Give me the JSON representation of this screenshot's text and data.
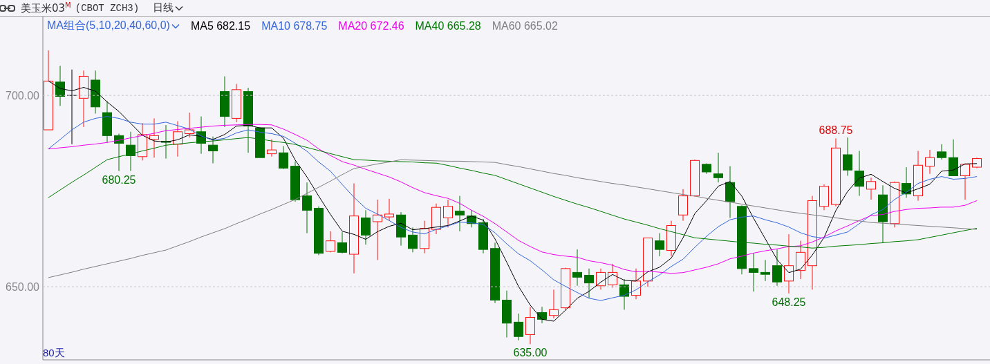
{
  "header": {
    "title": "美玉米03$^{M}$",
    "code": "(CBOT ZCH3)",
    "period": "日线"
  },
  "ma_selector": "MA组合(5,10,20,40,60,0)",
  "day_count": "80天",
  "price_chart": {
    "chart_data": {
      "type": "candlestick",
      "ylim": [
        630.9,
        720.6
      ],
      "yticks": [
        {
          "value": 700,
          "label": "700.00"
        },
        {
          "value": 650,
          "label": "650.00"
        }
      ],
      "ohlc": [
        [
          691,
          711.75,
          691,
          703.75
        ],
        [
          703.5,
          707.75,
          697.25,
          699.75
        ],
        [
          700,
          706.75,
          687.25,
          700
        ],
        [
          699.25,
          706.5,
          691.75,
          705
        ],
        [
          704,
          706.5,
          695.25,
          697
        ],
        [
          695.5,
          698.5,
          687.75,
          689.5
        ],
        [
          689.5,
          690,
          680.25,
          687.5
        ],
        [
          687,
          690.5,
          680.25,
          684.25
        ],
        [
          684,
          692.75,
          683,
          689.75
        ],
        [
          688.5,
          694,
          683.75,
          689.5
        ],
        [
          688,
          692.25,
          683.5,
          687.75
        ],
        [
          687.25,
          693.25,
          684,
          690.5
        ],
        [
          690,
          695.5,
          689,
          691
        ],
        [
          690.5,
          694.5,
          684.75,
          687.5
        ],
        [
          687,
          689.25,
          682.25,
          685.5
        ],
        [
          701,
          705,
          691.75,
          694.5
        ],
        [
          694,
          703,
          693,
          701.5
        ],
        [
          701,
          702,
          685,
          692
        ],
        [
          691.5,
          691.75,
          683.75,
          683.75
        ],
        [
          684.75,
          688.5,
          684,
          685.75
        ],
        [
          685,
          686.75,
          680.75,
          681
        ],
        [
          681.5,
          682.75,
          672.25,
          672.75
        ],
        [
          673.75,
          677.25,
          664,
          670
        ],
        [
          670.5,
          671,
          658.25,
          658.75
        ],
        [
          659.25,
          664.5,
          659,
          662
        ],
        [
          661.5,
          664.25,
          658.75,
          659
        ],
        [
          658.5,
          677,
          653.5,
          668.5
        ],
        [
          668,
          670,
          661,
          663.5
        ],
        [
          667,
          672.75,
          657,
          668.75
        ],
        [
          668.25,
          673,
          667.25,
          669
        ],
        [
          668.75,
          669.5,
          660.75,
          663
        ],
        [
          663.5,
          665.5,
          659,
          660
        ],
        [
          660,
          667.25,
          658.75,
          665.25
        ],
        [
          665,
          671.75,
          663.75,
          670.75
        ],
        [
          668,
          672.75,
          665.5,
          671
        ],
        [
          669.75,
          673.75,
          664.5,
          668.75
        ],
        [
          668.5,
          670,
          665.5,
          666.5
        ],
        [
          666.75,
          667.75,
          658.75,
          659.75
        ],
        [
          660,
          661.5,
          645.75,
          646.5
        ],
        [
          646.5,
          649,
          636.75,
          640.5
        ],
        [
          640.75,
          643,
          636,
          637
        ],
        [
          637.5,
          644.75,
          635,
          642
        ],
        [
          643.25,
          644.75,
          640.5,
          641.5
        ],
        [
          642.5,
          649.25,
          641.75,
          644
        ],
        [
          644.5,
          655,
          644,
          654.75
        ],
        [
          653.75,
          659.75,
          650.25,
          652.5
        ],
        [
          653,
          654.75,
          647,
          651
        ],
        [
          650.25,
          654.75,
          649.25,
          653.75
        ],
        [
          650.5,
          656,
          649.75,
          653.75
        ],
        [
          650.5,
          652,
          644,
          647.5
        ],
        [
          647.75,
          654.75,
          646.75,
          651.5
        ],
        [
          651.5,
          662.75,
          650,
          662.75
        ],
        [
          662,
          664,
          658,
          659.75
        ],
        [
          659.5,
          667.25,
          658,
          666
        ],
        [
          668.75,
          675.5,
          667.25,
          673.75
        ],
        [
          673.75,
          683.25,
          673.5,
          683
        ],
        [
          682,
          682.25,
          679.5,
          680
        ],
        [
          679.5,
          685,
          677.25,
          678.5
        ],
        [
          677.25,
          681.5,
          668,
          672.25
        ],
        [
          671,
          671.25,
          653.25,
          654.75
        ],
        [
          654.75,
          658.75,
          648.75,
          653.75
        ],
        [
          653.75,
          657,
          651.5,
          653.25
        ],
        [
          655.5,
          659.75,
          650.25,
          651.25
        ],
        [
          651.5,
          663.75,
          648.25,
          655.5
        ],
        [
          654.25,
          662,
          652,
          659
        ],
        [
          655.5,
          673.75,
          649.25,
          672.5
        ],
        [
          671,
          676.75,
          670,
          676.25
        ],
        [
          671.5,
          688.75,
          671,
          686.25
        ],
        [
          684.5,
          689,
          679,
          680.5
        ],
        [
          680.25,
          685.5,
          673.75,
          676.25
        ],
        [
          675.5,
          678.5,
          672.75,
          677.5
        ],
        [
          674,
          676.5,
          661.5,
          667
        ],
        [
          666.5,
          677.5,
          665.5,
          677.25
        ],
        [
          677,
          681.25,
          673.25,
          674.25
        ],
        [
          673.75,
          685.5,
          672.5,
          681.75
        ],
        [
          681.5,
          685.75,
          679.5,
          683.75
        ],
        [
          685.25,
          687.25,
          683.25,
          683.75
        ],
        [
          683.75,
          688.5,
          679,
          679
        ],
        [
          679,
          682.25,
          672.75,
          682
        ],
        [
          681.25,
          683.75,
          681,
          683.5
        ]
      ],
      "annotations": [
        "680.25",
        "635.00",
        "648.25",
        "688.75"
      ]
    }
  },
  "ma_chart": {
    "chart_data": {
      "type": "line",
      "ylim": [
        630.9,
        720.6
      ],
      "series": [
        {
          "name": "MA5 682.15",
          "color": "#000000",
          "values": [
            703.8,
            701.8,
            701.2,
            702.1,
            701.1,
            698.3,
            695.8,
            692.7,
            689.6,
            688.1,
            687.8,
            688.4,
            689.7,
            689.3,
            688.5,
            689.8,
            692,
            692.2,
            691.5,
            691.5,
            688.8,
            683.1,
            678.7,
            673.7,
            668.9,
            664.5,
            663.7,
            662.4,
            664.4,
            665.8,
            666.6,
            664.9,
            665.2,
            665.6,
            666,
            667.2,
            668.5,
            667.4,
            662.5,
            656.4,
            650.1,
            645.2,
            641.5,
            641,
            643.9,
            647,
            648.8,
            651.2,
            653.2,
            651.7,
            651.5,
            653.9,
            655.1,
            657.5,
            662.8,
            669.1,
            672.5,
            676.3,
            677.5,
            673.7,
            667.9,
            662.5,
            657.1,
            653.7,
            654.6,
            658.3,
            662.9,
            669.9,
            674.9,
            678.4,
            679.4,
            677.5,
            675.7,
            674.5,
            675.6,
            676.8,
            680.2,
            680.5,
            682.1,
            682.2
          ]
        },
        {
          "name": "MA10 678.75",
          "color": "#3366dd",
          "values": [
            686,
            688.5,
            691,
            693,
            694,
            694.5,
            694,
            693,
            692.5,
            692.5,
            693,
            692.1,
            691.2,
            689.4,
            688.3,
            688.8,
            690.2,
            691,
            690.4,
            690,
            689.3,
            687.5,
            685.4,
            682.6,
            680.2,
            676.7,
            673.4,
            670.5,
            669,
            667.3,
            665.5,
            664.3,
            663.8,
            665,
            665.9,
            666.9,
            666.7,
            666.3,
            664.1,
            661.2,
            658.6,
            656.8,
            654.4,
            651.8,
            650.1,
            648.5,
            647,
            646.4,
            647.1,
            647.8,
            649.2,
            651.3,
            653.1,
            655.3,
            657.2,
            660.3,
            663.2,
            665.7,
            667.5,
            668.2,
            668.5,
            667.5,
            666.7,
            665.6,
            664.1,
            663.1,
            662.7,
            663.5,
            664.3,
            666.5,
            668.8,
            670.2,
            672.8,
            674.7,
            677,
            678.1,
            678.8,
            678.1,
            678.3,
            678.8
          ]
        },
        {
          "name": "MA20 672.46",
          "color": "#ee00ee",
          "values": [
            686,
            686.3,
            686.6,
            687,
            687.3,
            687.7,
            688.3,
            688.9,
            689.5,
            690.1,
            690.8,
            691.1,
            691.4,
            691.7,
            692,
            692.2,
            692.3,
            692.4,
            692.4,
            692.3,
            691.2,
            689.8,
            688.3,
            686,
            684.3,
            682.7,
            681.8,
            680.7,
            679.7,
            678.7,
            677.4,
            675.9,
            674.6,
            673.8,
            673.1,
            671.8,
            670,
            668.4,
            666.5,
            664.3,
            662.1,
            660.5,
            659.1,
            658.4,
            658,
            657.7,
            656.8,
            656.3,
            655.6,
            654.5,
            653.9,
            654.1,
            653.8,
            653.5,
            653.7,
            654.4,
            655.1,
            656,
            657.3,
            658,
            658.8,
            659.4,
            659.9,
            660.5,
            660.7,
            661.7,
            663,
            664.6,
            665.9,
            667.3,
            668.6,
            668.9,
            669.7,
            670.2,
            670.5,
            670.6,
            670.8,
            670.8,
            671.3,
            672.5
          ]
        },
        {
          "name": "MA40 665.28",
          "color": "#007a00",
          "values": [
            673.3,
            675.3,
            677.3,
            679.2,
            681.2,
            683.2,
            684.0,
            684.7,
            685.5,
            686.2,
            687.0,
            687.3,
            687.6,
            687.9,
            688.1,
            688.4,
            688.7,
            689.0,
            688.6,
            688.1,
            687.7,
            687.2,
            686.4,
            685.6,
            684.8,
            684.0,
            683.2,
            683.1,
            682.9,
            682.8,
            682.7,
            682.6,
            682.4,
            682.3,
            681.7,
            681.0,
            680.4,
            679.7,
            679.1,
            678.0,
            676.9,
            675.8,
            674.7,
            673.6,
            672.6,
            671.6,
            670.7,
            669.7,
            668.7,
            667.7,
            666.9,
            666.1,
            665.2,
            664.4,
            663.6,
            662.8,
            662.5,
            662.2,
            661.9,
            661.6,
            661.4,
            661.1,
            660.9,
            660.6,
            660.4,
            660.1,
            660.3,
            660.6,
            660.8,
            661.0,
            661.3,
            661.5,
            661.8,
            662.0,
            662.3,
            662.9,
            663.5,
            664.1,
            664.7,
            665.3
          ]
        },
        {
          "name": "MA60 665.02",
          "color": "#808080",
          "values": [
            652.4,
            653.1,
            653.8,
            654.6,
            655.3,
            656.0,
            656.7,
            657.4,
            658.2,
            658.9,
            659.6,
            660.7,
            661.8,
            663.0,
            664.1,
            665.2,
            666.5,
            667.7,
            669.0,
            670.2,
            671.5,
            672.8,
            674.4,
            676.0,
            677.6,
            679.3,
            680.9,
            681.5,
            682.1,
            682.6,
            683.2,
            683.1,
            683.0,
            682.9,
            682.8,
            682.8,
            682.7,
            682.6,
            682.5,
            681.9,
            681.4,
            680.8,
            680.2,
            679.6,
            679.1,
            678.5,
            678.0,
            677.5,
            677.0,
            676.6,
            676.1,
            675.6,
            675.1,
            674.6,
            674.1,
            673.7,
            673.1,
            672.6,
            672.1,
            671.6,
            671.1,
            670.6,
            670.1,
            669.6,
            669.2,
            668.8,
            668.4,
            668.0,
            667.6,
            667.2,
            666.8,
            666.6,
            666.4,
            666.2,
            666.0,
            665.8,
            665.6,
            665.4,
            665.2,
            665.0
          ]
        }
      ]
    }
  }
}
